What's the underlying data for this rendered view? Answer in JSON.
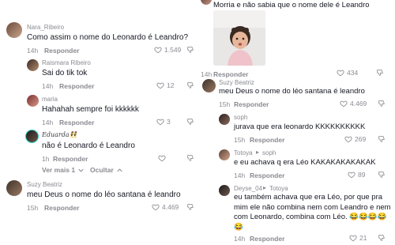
{
  "left": {
    "comments": [
      {
        "name": "Nara_Ribeiro",
        "text": "Como assim o nome do Leonardo é Leandro?",
        "time": "14h",
        "reply": "Responder",
        "likes": "1.549"
      },
      {
        "name": "Raismara Ribeiro",
        "text": "Sai do tik tok",
        "time": "14h",
        "reply": "Responder",
        "likes": "12"
      },
      {
        "name": "maria",
        "text": "Hahahah sempre foi kkkkkk",
        "time": "14h",
        "reply": "Responder",
        "likes": "3"
      },
      {
        "name": "Eduarda👯",
        "text": "não é Leonardo é Leandro",
        "time": "1h",
        "reply": "Responder",
        "likes": ""
      },
      {
        "name": "Suzy Beatriz",
        "text": "meu Deus o nome do léo santana é leandro",
        "time": "15h",
        "reply": "Responder",
        "likes": "4.469"
      }
    ],
    "view_more": "Ver mais 1",
    "hide": "Ocultar"
  },
  "right": {
    "top_text": "Morria e não sabia que o nome dele é Leandro",
    "image_likes": "434",
    "image_time": "14h",
    "image_reply": "Responder",
    "comments": [
      {
        "name": "Suzy Beatriz",
        "text": "meu Deus o nome do léo santana é leandro",
        "time": "15h",
        "reply": "Responder",
        "likes": "4.469"
      },
      {
        "name": "soph",
        "text": "jurava que era leonardo KKKKKKKKKK",
        "time": "15h",
        "reply": "Responder",
        "likes": "269"
      },
      {
        "name": "Totoya",
        "reply_to": "soph",
        "text": "e eu achava q era Léo KAKAKAKAKAKAK",
        "time": "14h",
        "reply": "Responder",
        "likes": "89"
      },
      {
        "name": "Deyse_04",
        "reply_to": "Totoya",
        "text": "eu também achava que era Léo, por que pra mim ele não combina nem com Leandro e nem com Leonardo, combina com Léo. 😂😂😂😂😂",
        "time": "14h",
        "reply": "Responder",
        "likes": "21"
      }
    ]
  }
}
